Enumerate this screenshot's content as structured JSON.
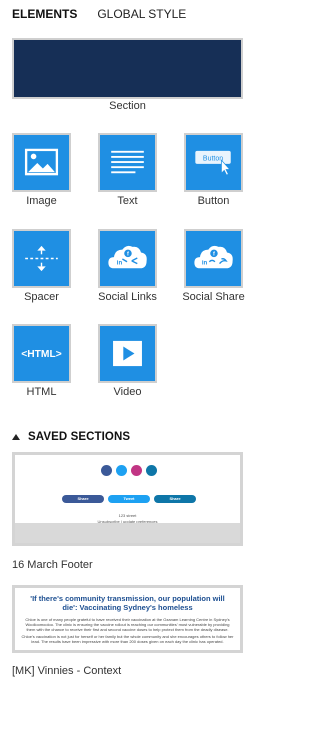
{
  "tabs": {
    "elements": "ELEMENTS",
    "global_style": "GLOBAL STYLE"
  },
  "elements": {
    "section": "Section",
    "image": "Image",
    "text": "Text",
    "button": "Button",
    "button_preview": "Button",
    "spacer": "Spacer",
    "social_links": "Social Links",
    "social_share": "Social Share",
    "html": "HTML",
    "html_icon_text": "<HTML>",
    "video": "Video"
  },
  "saved_sections": {
    "title": "SAVED SECTIONS",
    "items": [
      {
        "label": "16 March Footer",
        "share_buttons": [
          "Share",
          "Tweet",
          "Share"
        ],
        "street": "123 street",
        "unsubscribe": "Unsubscribe",
        "separator": "|",
        "update_prefs": "update preferences"
      },
      {
        "label": "[MK] Vinnies - Context",
        "headline_line1": "'If there's community transmission, our population will",
        "headline_line2": "die': Vaccinating Sydney's homeless",
        "para1": "Chloe is one of many people grateful to have received their vaccination at the Ozanam Learning Centre in Sydney's Woolloomooloo. The clinic is ensuring the vaccine rollout is reaching our communities' most vulnerable by providing them with the chance to receive their first and second vaccine doses to help protect them from the deadly disease.",
        "para2": "Chloe's vaccination is not just for herself or her family but the whole community and she encourages others to follow her lead. The results have been impressive with more than 200 doses given on each day the clinic has operated."
      }
    ]
  },
  "colors": {
    "tile_blue": "#1f8fe3",
    "section_navy": "#162f56",
    "facebook": "#3b5998",
    "twitter": "#1da1f2",
    "instagram": "#c13584",
    "linkedin": "#0e76a8",
    "headline_blue": "#1d4f91"
  },
  "icons": {
    "image": "image-icon",
    "text": "text-lines-icon",
    "button": "button-cursor-icon",
    "spacer": "spacer-icon",
    "social_links": "cloud-social-links-icon",
    "social_share": "cloud-social-share-icon",
    "html": "html-code-icon",
    "video": "play-icon"
  }
}
